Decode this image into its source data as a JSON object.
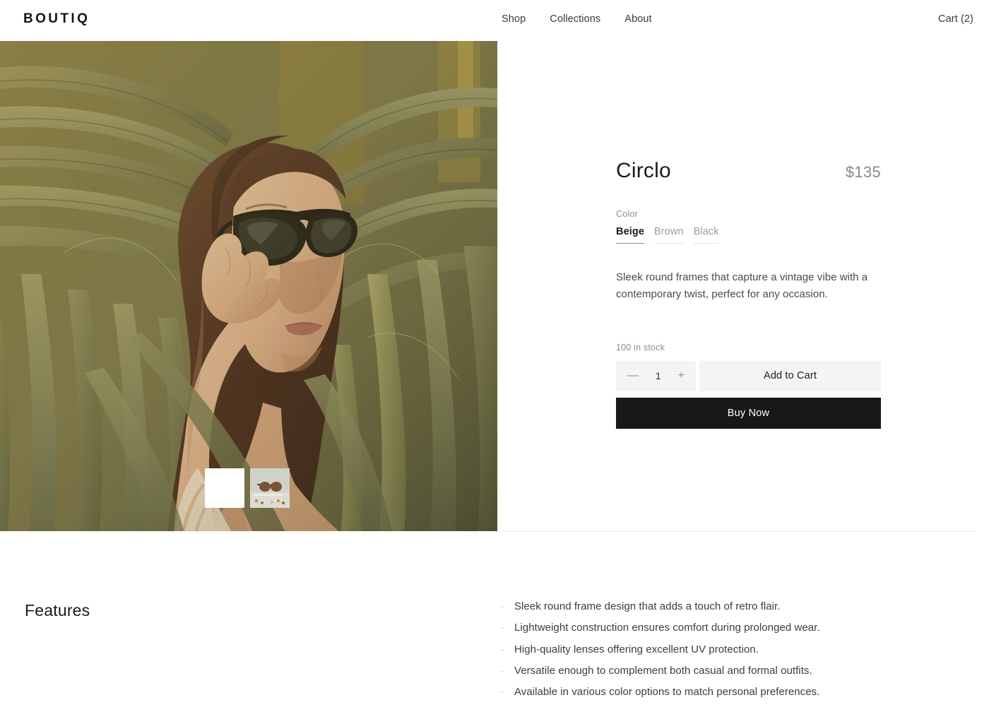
{
  "header": {
    "logo": "BOUTIQ",
    "nav": [
      {
        "label": "Shop"
      },
      {
        "label": "Collections"
      },
      {
        "label": "About"
      }
    ],
    "cart": "Cart (2)"
  },
  "gallery": {
    "alt": "Woman wearing Circlo sunglasses among palm fronds",
    "thumbnails": [
      {
        "name": "thumbnail-1",
        "type": "blank",
        "selected": true
      },
      {
        "name": "thumbnail-2",
        "type": "sunglasses-flatlay",
        "selected": false
      }
    ]
  },
  "product": {
    "title": "Circlo",
    "price": "$135",
    "option_label": "Color",
    "options": [
      {
        "label": "Beige",
        "selected": true
      },
      {
        "label": "Brown",
        "selected": false
      },
      {
        "label": "Black",
        "selected": false
      }
    ],
    "description": "Sleek round frames that capture a vintage vibe with a contemporary twist, perfect for any occasion.",
    "stock": "100 in stock",
    "quantity": {
      "decrement": "—",
      "value": "1",
      "increment": "+"
    },
    "add_to_cart": "Add to Cart",
    "buy_now": "Buy Now"
  },
  "features": {
    "heading": "Features",
    "bullet": "·",
    "items": [
      "Sleek round frame design that adds a touch of retro flair.",
      "Lightweight construction ensures comfort during prolonged wear.",
      "High-quality lenses offering excellent UV protection.",
      "Versatile enough to complement both casual and formal outfits.",
      "Available in various color options to match personal preferences."
    ]
  },
  "colors": {
    "text_primary": "#1c1c1c",
    "text_muted": "#8d8d8d",
    "button_dark": "#16181a",
    "button_light": "#f4f4f4",
    "divider": "#ededed"
  }
}
